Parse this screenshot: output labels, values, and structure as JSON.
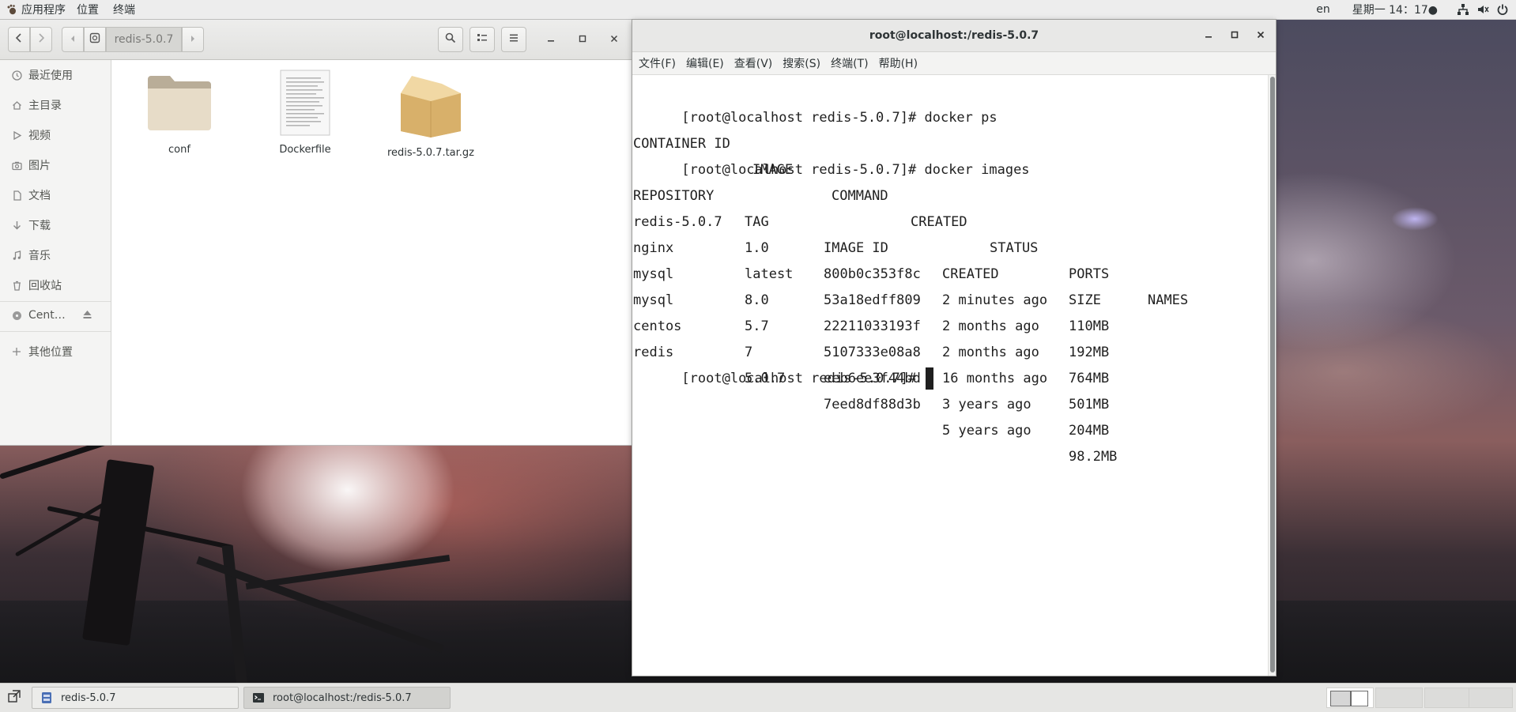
{
  "topbar": {
    "apps_menu": "应用程序",
    "places_menu": "位置",
    "terminal_menu": "终端",
    "lang": "en",
    "clock": "星期一 14：17●"
  },
  "file_manager": {
    "path_current": "redis-5.0.7",
    "sidebar": [
      {
        "label": "最近使用",
        "icon": "clock-icon"
      },
      {
        "label": "主目录",
        "icon": "home-icon"
      },
      {
        "label": "视频",
        "icon": "video-icon"
      },
      {
        "label": "图片",
        "icon": "camera-icon"
      },
      {
        "label": "文档",
        "icon": "document-icon"
      },
      {
        "label": "下载",
        "icon": "download-icon"
      },
      {
        "label": "音乐",
        "icon": "music-icon"
      },
      {
        "label": "回收站",
        "icon": "trash-icon"
      },
      {
        "label": "Cent…",
        "icon": "disc-icon"
      },
      {
        "label": "其他位置",
        "icon": "plus-icon"
      }
    ],
    "files": [
      {
        "name": "conf",
        "type": "folder"
      },
      {
        "name": "Dockerfile",
        "type": "text-file"
      },
      {
        "name": "redis-5.0.7.tar.gz",
        "type": "archive"
      }
    ]
  },
  "terminal": {
    "title": "root@localhost:/redis-5.0.7",
    "menu": [
      "文件(F)",
      "编辑(E)",
      "查看(V)",
      "搜索(S)",
      "终端(T)",
      "帮助(H)"
    ],
    "prompt": "[root@localhost redis-5.0.7]#",
    "cmd1": "docker ps",
    "ps_header": [
      "CONTAINER ID",
      "IMAGE",
      "COMMAND",
      "CREATED",
      "STATUS",
      "PORTS",
      "NAMES"
    ],
    "cmd2": "docker images",
    "images_header": [
      "REPOSITORY",
      "TAG",
      "IMAGE ID",
      "CREATED",
      "SIZE"
    ],
    "images": [
      [
        "redis-5.0.7",
        "1.0",
        "800b0c353f8c",
        "2 minutes ago",
        "110MB"
      ],
      [
        "nginx",
        "latest",
        "53a18edff809",
        "2 months ago",
        "192MB"
      ],
      [
        "mysql",
        "8.0",
        "22211033193f",
        "2 months ago",
        "764MB"
      ],
      [
        "mysql",
        "5.7",
        "5107333e08a8",
        "16 months ago",
        "501MB"
      ],
      [
        "centos",
        "7",
        "eeb6ee3f44bd",
        "3 years ago",
        "204MB"
      ],
      [
        "redis",
        "5.0.7",
        "7eed8df88d3b",
        "5 years ago",
        "98.2MB"
      ]
    ]
  },
  "taskbar": {
    "tasks": [
      "redis-5.0.7",
      "root@localhost:/redis-5.0.7"
    ]
  }
}
